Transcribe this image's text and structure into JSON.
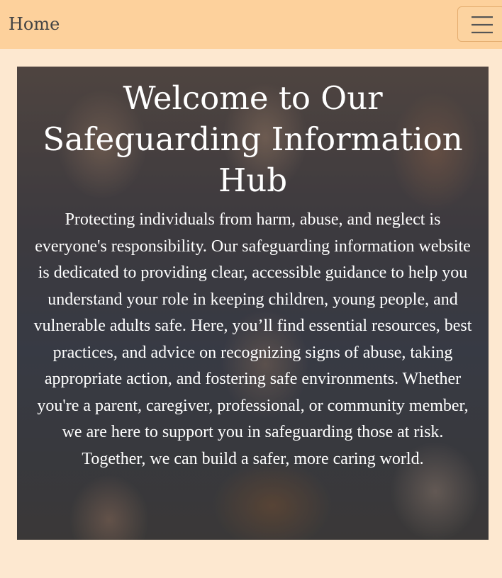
{
  "navbar": {
    "brand_label": "Home",
    "toggler_icon": "hamburger-menu-icon"
  },
  "hero": {
    "title": "Welcome to Our Safeguarding Information Hub",
    "body": "Protecting individuals from harm, abuse, and neglect is everyone's responsibility. Our safeguarding information website is dedicated to providing clear, accessible guidance to help you understand your role in keeping children, young people, and vulnerable adults safe. Here, you’ll find essential resources, best practices, and advice on recognizing signs of abuse, taking appropriate action, and fostering safe environments. Whether you're a parent, caregiver, professional, or community member, we are here to support you in safeguarding those at risk. Together, we can build a safer, more caring world."
  },
  "colors": {
    "navbar_bg": "#fdd19c",
    "page_bg": "#fde8d0",
    "text_on_image": "#ffffff"
  }
}
